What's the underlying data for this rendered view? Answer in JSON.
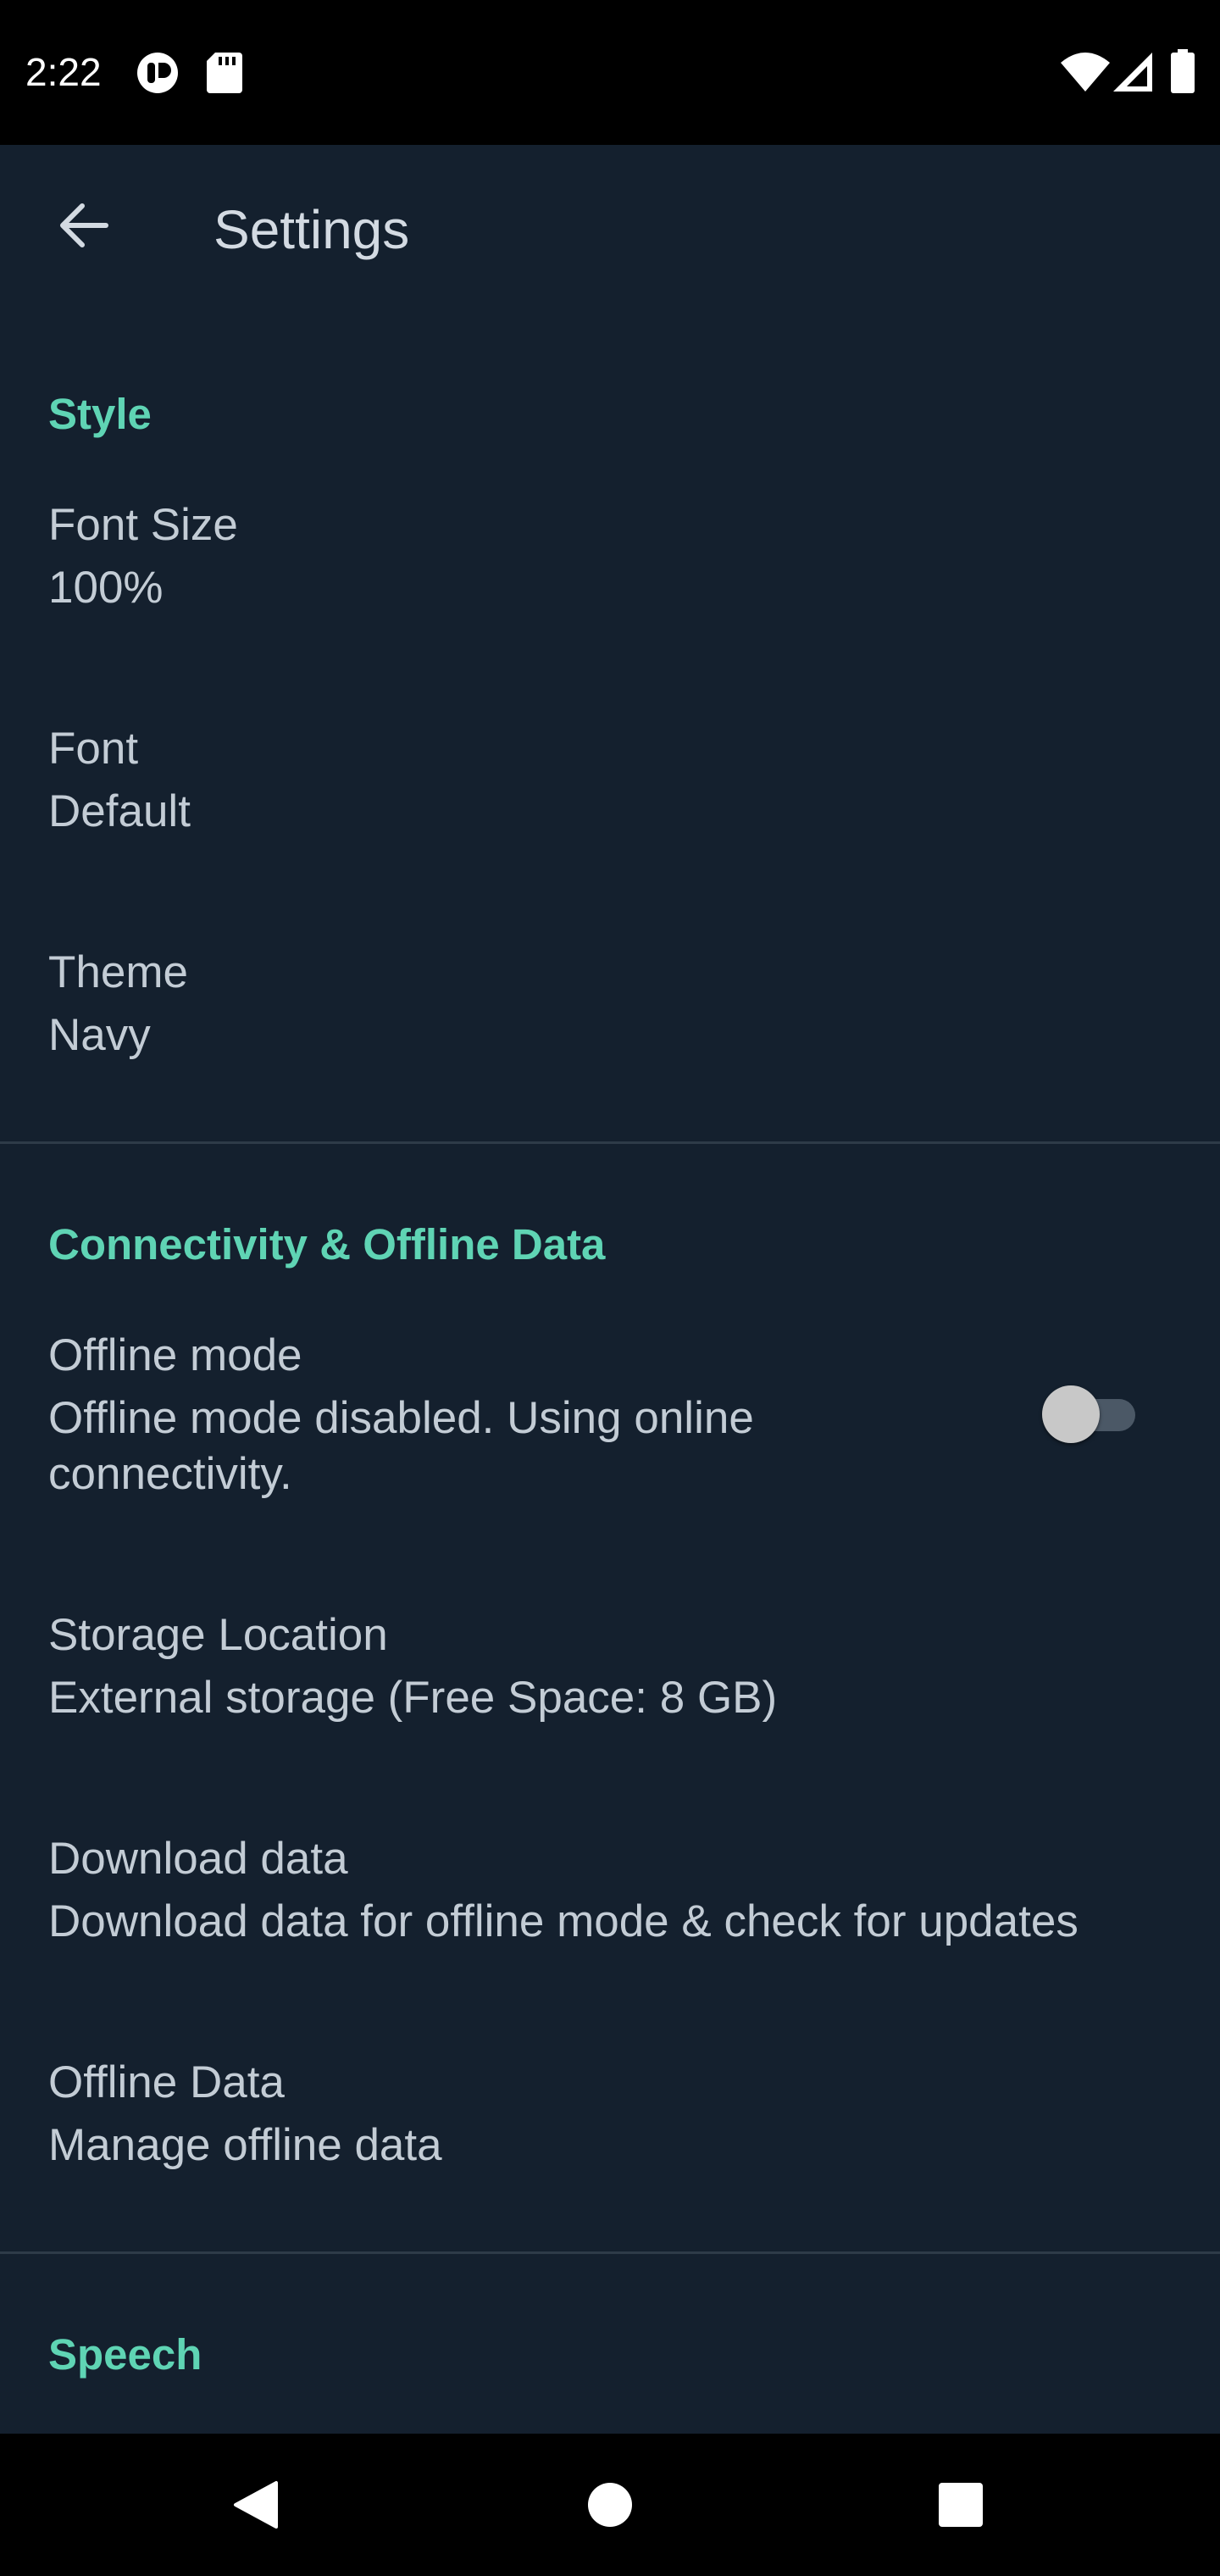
{
  "status_bar": {
    "time": "2:22",
    "left_icons": [
      "notification-app-icon",
      "sd-card-icon"
    ],
    "right_icons": [
      "wifi-icon",
      "cell-signal-icon",
      "battery-icon"
    ]
  },
  "app_bar": {
    "title": "Settings",
    "back_icon": "arrow-back-icon"
  },
  "sections": {
    "style": {
      "header": "Style",
      "font_size": {
        "title": "Font Size",
        "summary": "100%"
      },
      "font": {
        "title": "Font",
        "summary": "Default"
      },
      "theme": {
        "title": "Theme",
        "summary": "Navy"
      }
    },
    "connectivity": {
      "header": "Connectivity & Offline Data",
      "offline_mode": {
        "title": "Offline mode",
        "summary_line1": "Offline mode disabled. Using online",
        "summary_line2": "connectivity.",
        "enabled": false
      },
      "storage_location": {
        "title": "Storage Location",
        "summary": "External storage (Free Space: 8 GB)"
      },
      "download_data": {
        "title": "Download data",
        "summary": "Download data for offline mode & check for updates"
      },
      "offline_data": {
        "title": "Offline Data",
        "summary": "Manage offline data"
      }
    },
    "speech": {
      "header": "Speech"
    }
  },
  "nav_bar": {
    "buttons": [
      "back-triangle-icon",
      "home-circle-icon",
      "recents-square-icon"
    ]
  },
  "colors": {
    "background": "#14202e",
    "accent": "#5fd4b4",
    "text": "#c3ccd5",
    "divider": "#2e3b48",
    "system_bars": "#000000"
  }
}
